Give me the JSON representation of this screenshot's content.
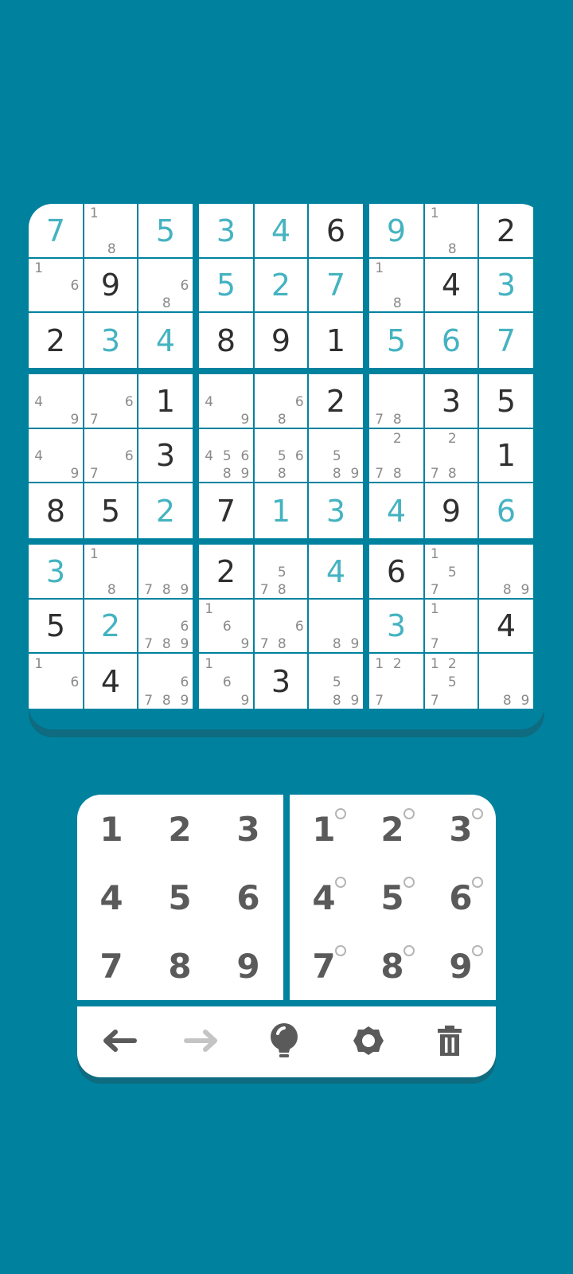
{
  "board": {
    "cells": [
      [
        {
          "v": "7",
          "t": "entered"
        },
        {
          "notes": [
            "1",
            "",
            "",
            "",
            "",
            "",
            "",
            "8",
            ""
          ]
        },
        {
          "v": "5",
          "t": "entered"
        },
        {
          "v": "3",
          "t": "entered"
        },
        {
          "v": "4",
          "t": "entered"
        },
        {
          "v": "6",
          "t": "given"
        },
        {
          "v": "9",
          "t": "entered"
        },
        {
          "notes": [
            "1",
            "",
            "",
            "",
            "",
            "",
            "",
            "8",
            ""
          ]
        },
        {
          "v": "2",
          "t": "given"
        }
      ],
      [
        {
          "notes": [
            "1",
            "",
            "",
            "",
            "",
            "6",
            "",
            "",
            ""
          ]
        },
        {
          "v": "9",
          "t": "given"
        },
        {
          "notes": [
            "",
            "",
            "",
            "",
            "",
            "6",
            "",
            "8",
            ""
          ]
        },
        {
          "v": "5",
          "t": "entered"
        },
        {
          "v": "2",
          "t": "entered"
        },
        {
          "v": "7",
          "t": "entered"
        },
        {
          "notes": [
            "1",
            "",
            "",
            "",
            "",
            "",
            "",
            "8",
            ""
          ]
        },
        {
          "v": "4",
          "t": "given"
        },
        {
          "v": "3",
          "t": "entered"
        }
      ],
      [
        {
          "v": "2",
          "t": "given"
        },
        {
          "v": "3",
          "t": "entered"
        },
        {
          "v": "4",
          "t": "entered"
        },
        {
          "v": "8",
          "t": "given"
        },
        {
          "v": "9",
          "t": "given"
        },
        {
          "v": "1",
          "t": "given"
        },
        {
          "v": "5",
          "t": "entered"
        },
        {
          "v": "6",
          "t": "entered"
        },
        {
          "v": "7",
          "t": "entered"
        }
      ],
      [
        {
          "notes": [
            "",
            "",
            "",
            "4",
            "",
            "",
            "",
            "",
            "9"
          ]
        },
        {
          "notes": [
            "",
            "",
            "",
            "",
            "",
            "6",
            "7",
            "",
            ""
          ]
        },
        {
          "v": "1",
          "t": "given"
        },
        {
          "notes": [
            "",
            "",
            "",
            "4",
            "",
            "",
            "",
            "",
            "9"
          ]
        },
        {
          "notes": [
            "",
            "",
            "",
            "",
            "",
            "6",
            "",
            "8",
            ""
          ]
        },
        {
          "v": "2",
          "t": "given"
        },
        {
          "notes": [
            "",
            "",
            "",
            "",
            "",
            "",
            "7",
            "8",
            ""
          ]
        },
        {
          "v": "3",
          "t": "given"
        },
        {
          "v": "5",
          "t": "given"
        }
      ],
      [
        {
          "notes": [
            "",
            "",
            "",
            "4",
            "",
            "",
            "",
            "",
            "9"
          ]
        },
        {
          "notes": [
            "",
            "",
            "",
            "",
            "",
            "6",
            "7",
            "",
            ""
          ]
        },
        {
          "v": "3",
          "t": "given"
        },
        {
          "notes": [
            "",
            "",
            "",
            "4",
            "5",
            "6",
            "",
            "8",
            "9"
          ]
        },
        {
          "notes": [
            "",
            "",
            "",
            "",
            "5",
            "6",
            "",
            "8",
            ""
          ]
        },
        {
          "notes": [
            "",
            "",
            "",
            "",
            "5",
            "",
            "",
            "8",
            "9"
          ]
        },
        {
          "notes": [
            "",
            "2",
            "",
            "",
            "",
            "",
            "7",
            "8",
            ""
          ]
        },
        {
          "notes": [
            "",
            "2",
            "",
            "",
            "",
            "",
            "7",
            "8",
            ""
          ]
        },
        {
          "v": "1",
          "t": "given"
        }
      ],
      [
        {
          "v": "8",
          "t": "given"
        },
        {
          "v": "5",
          "t": "given"
        },
        {
          "v": "2",
          "t": "entered"
        },
        {
          "v": "7",
          "t": "given"
        },
        {
          "v": "1",
          "t": "entered"
        },
        {
          "v": "3",
          "t": "entered"
        },
        {
          "v": "4",
          "t": "entered"
        },
        {
          "v": "9",
          "t": "given"
        },
        {
          "v": "6",
          "t": "entered"
        }
      ],
      [
        {
          "v": "3",
          "t": "entered"
        },
        {
          "notes": [
            "1",
            "",
            "",
            "",
            "",
            "",
            "",
            "8",
            ""
          ]
        },
        {
          "notes": [
            "",
            "",
            "",
            "",
            "",
            "",
            "7",
            "8",
            "9"
          ]
        },
        {
          "v": "2",
          "t": "given"
        },
        {
          "notes": [
            "",
            "",
            "",
            "",
            "5",
            "",
            "7",
            "8",
            ""
          ]
        },
        {
          "v": "4",
          "t": "entered"
        },
        {
          "v": "6",
          "t": "given"
        },
        {
          "notes": [
            "1",
            "",
            "",
            "",
            "5",
            "",
            "7",
            "",
            ""
          ]
        },
        {
          "notes": [
            "",
            "",
            "",
            "",
            "",
            "",
            "",
            "8",
            "9"
          ]
        }
      ],
      [
        {
          "v": "5",
          "t": "given"
        },
        {
          "v": "2",
          "t": "entered"
        },
        {
          "notes": [
            "",
            "",
            "",
            "",
            "",
            "6",
            "7",
            "8",
            "9"
          ]
        },
        {
          "notes": [
            "1",
            "",
            "",
            "",
            "6",
            "",
            "",
            "",
            "9"
          ]
        },
        {
          "notes": [
            "",
            "",
            "",
            "",
            "",
            "6",
            "7",
            "8",
            ""
          ]
        },
        {
          "notes": [
            "",
            "",
            "",
            "",
            "",
            "",
            "",
            "8",
            "9"
          ]
        },
        {
          "v": "3",
          "t": "entered"
        },
        {
          "notes": [
            "1",
            "",
            "",
            "",
            "",
            "",
            "7",
            "",
            ""
          ]
        },
        {
          "v": "4",
          "t": "given"
        }
      ],
      [
        {
          "notes": [
            "1",
            "",
            "",
            "",
            "",
            "6",
            "",
            "",
            ""
          ]
        },
        {
          "v": "4",
          "t": "given"
        },
        {
          "notes": [
            "",
            "",
            "",
            "",
            "",
            "6",
            "7",
            "8",
            "9"
          ]
        },
        {
          "notes": [
            "1",
            "",
            "",
            "",
            "6",
            "",
            "",
            "",
            "9"
          ]
        },
        {
          "v": "3",
          "t": "given"
        },
        {
          "notes": [
            "",
            "",
            "",
            "",
            "5",
            "",
            "",
            "8",
            "9"
          ]
        },
        {
          "notes": [
            "1",
            "2",
            "",
            "",
            "",
            "",
            "7",
            "",
            ""
          ]
        },
        {
          "notes": [
            "1",
            "2",
            "",
            "",
            "5",
            "",
            "7",
            "",
            ""
          ]
        },
        {
          "notes": [
            "",
            "",
            "",
            "",
            "",
            "",
            "",
            "8",
            "9"
          ]
        }
      ]
    ]
  },
  "keypad": {
    "digits": [
      "1",
      "2",
      "3",
      "4",
      "5",
      "6",
      "7",
      "8",
      "9"
    ],
    "note_digits": [
      "1",
      "2",
      "3",
      "4",
      "5",
      "6",
      "7",
      "8",
      "9"
    ]
  },
  "toolbar": {
    "tools": [
      {
        "name": "undo-button",
        "icon": "arrow-left-icon",
        "enabled": true
      },
      {
        "name": "redo-button",
        "icon": "arrow-right-icon",
        "enabled": false
      },
      {
        "name": "hint-button",
        "icon": "lightbulb-icon",
        "enabled": true
      },
      {
        "name": "settings-button",
        "icon": "gear-icon",
        "enabled": true
      },
      {
        "name": "delete-button",
        "icon": "trash-icon",
        "enabled": true
      }
    ]
  },
  "colors": {
    "background": "#00829f",
    "given": "#2f2f2f",
    "entered": "#45b3c1",
    "note": "#8a8a8a",
    "icon": "#5a5a5a",
    "icon_disabled": "#c4c4c4"
  }
}
